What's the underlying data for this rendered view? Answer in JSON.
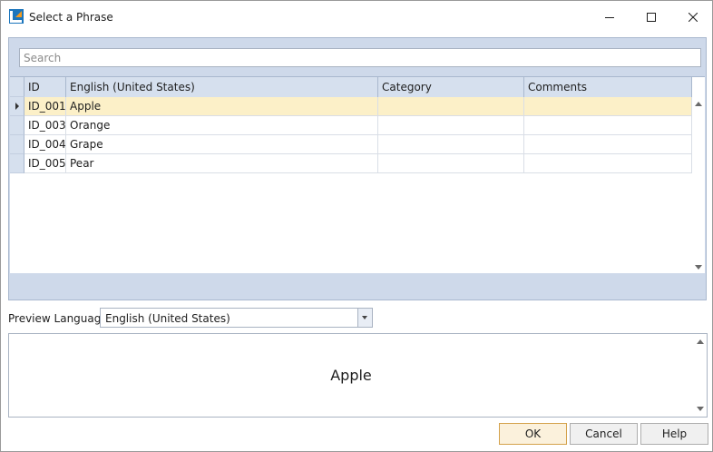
{
  "window": {
    "title": "Select a Phrase"
  },
  "search": {
    "placeholder": "Search",
    "value": ""
  },
  "grid": {
    "columns": [
      "ID",
      "English (United States)",
      "Category",
      "Comments"
    ],
    "rows": [
      {
        "id": "ID_001",
        "english": "Apple",
        "category": "",
        "comments": "",
        "selected": true
      },
      {
        "id": "ID_003",
        "english": "Orange",
        "category": "",
        "comments": "",
        "selected": false
      },
      {
        "id": "ID_004",
        "english": "Grape",
        "category": "",
        "comments": "",
        "selected": false
      },
      {
        "id": "ID_005",
        "english": "Pear",
        "category": "",
        "comments": "",
        "selected": false
      }
    ]
  },
  "preview": {
    "label": "Preview Language:",
    "language": "English (United States)",
    "text": "Apple"
  },
  "buttons": {
    "ok": "OK",
    "cancel": "Cancel",
    "help": "Help"
  },
  "icons": {
    "app": "app-logo-icon",
    "minimize": "minimize-icon",
    "maximize": "maximize-icon",
    "close": "close-icon",
    "row_pointer": "row-pointer-icon",
    "dropdown": "chevron-down-icon",
    "scroll_up": "scroll-up-icon",
    "scroll_down": "scroll-down-icon"
  },
  "colors": {
    "panel": "#ced9ea",
    "selected_row": "#fcf0c8",
    "ok_border": "#d4a24c",
    "logo_blue": "#1b75bc",
    "logo_orange": "#f39a1f"
  }
}
